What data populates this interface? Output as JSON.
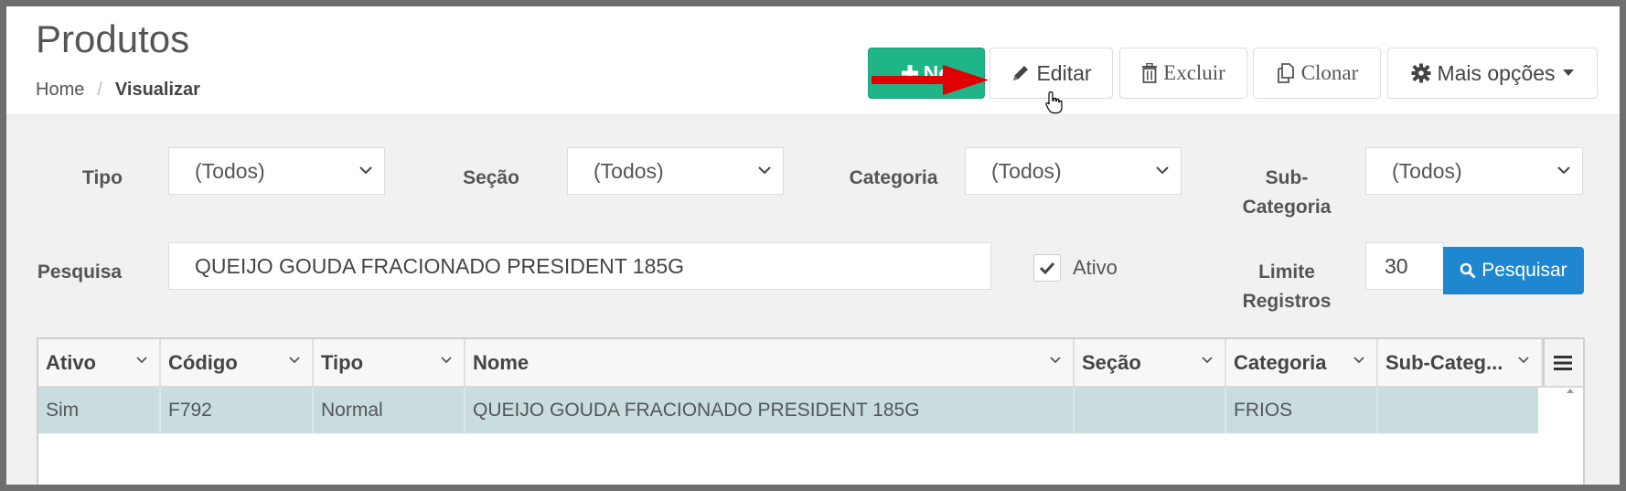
{
  "header": {
    "title": "Produtos",
    "breadcrumb": {
      "home": "Home",
      "separator": "/",
      "current": "Visualizar"
    }
  },
  "toolbar": {
    "new_label": "No",
    "edit_label": "Editar",
    "delete_label": "Excluir",
    "clone_label": "Clonar",
    "more_label": "Mais opções"
  },
  "filters": {
    "tipo": {
      "label": "Tipo",
      "value": "(Todos)"
    },
    "secao": {
      "label": "Seção",
      "value": "(Todos)"
    },
    "categoria": {
      "label": "Categoria",
      "value": "(Todos)"
    },
    "subcategoria": {
      "label_line1": "Sub-",
      "label_line2": "Categoria",
      "value": "(Todos)"
    },
    "pesquisa": {
      "label": "Pesquisa",
      "value": "QUEIJO GOUDA FRACIONADO PRESIDENT 185G"
    },
    "ativo": {
      "label": "Ativo",
      "checked": true
    },
    "limite": {
      "label_line1": "Limite",
      "label_line2": "Registros",
      "value": "30"
    },
    "search_button": "Pesquisar"
  },
  "grid": {
    "columns": [
      "Ativo",
      "Código",
      "Tipo",
      "Nome",
      "Seção",
      "Categoria",
      "Sub-Categ..."
    ],
    "rows": [
      [
        "Sim",
        "F792",
        "Normal",
        "QUEIJO GOUDA FRACIONADO PRESIDENT 185G",
        "",
        "FRIOS",
        ""
      ]
    ]
  },
  "colors": {
    "new_button": "#1fb589",
    "search_button": "#1f87cf",
    "selected_row": "#c9dde0",
    "annotation_arrow": "#e00000"
  }
}
